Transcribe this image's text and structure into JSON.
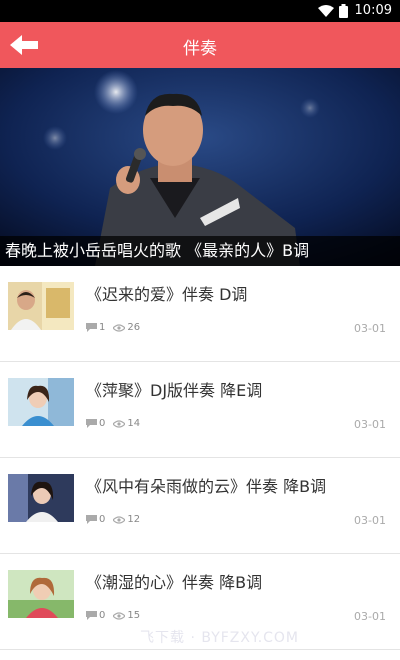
{
  "status_bar": {
    "time": "10:09"
  },
  "header": {
    "title": "伴奏",
    "back_icon": "back-arrow-icon"
  },
  "banner": {
    "caption": "春晚上被小岳岳唱火的歌 《最亲的人》B调"
  },
  "items": [
    {
      "title": "《迟来的爱》伴奏 D调",
      "comments": "1",
      "views": "26",
      "date": "03-01"
    },
    {
      "title": "《萍聚》DJ版伴奏 降E调",
      "comments": "0",
      "views": "14",
      "date": "03-01"
    },
    {
      "title": "《风中有朵雨做的云》伴奏 降B调",
      "comments": "0",
      "views": "12",
      "date": "03-01"
    },
    {
      "title": "《潮湿的心》伴奏 降B调",
      "comments": "0",
      "views": "15",
      "date": "03-01"
    }
  ],
  "watermark": "飞下载 · BYFZXY.COM",
  "colors": {
    "accent": "#f0575c",
    "status_bar": "#000000"
  }
}
